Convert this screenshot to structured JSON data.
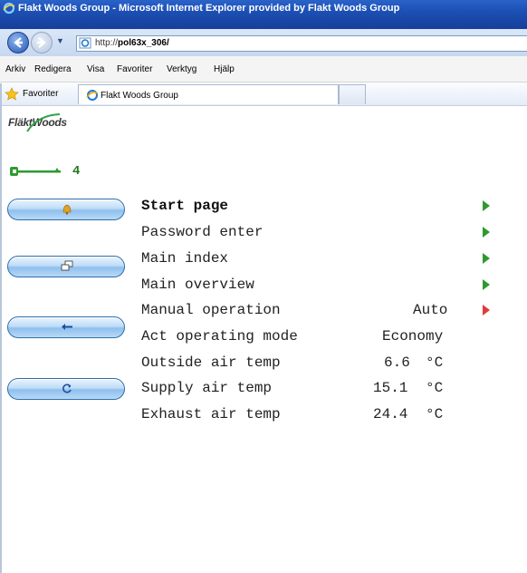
{
  "window": {
    "title": "Flakt Woods Group - Microsoft Internet Explorer provided by Flakt Woods Group",
    "url_prefix": "http://",
    "url_host": "pol63x_306/"
  },
  "menu": [
    "Arkiv",
    "Redigera",
    "Visa",
    "Favoriter",
    "Verktyg",
    "Hjälp"
  ],
  "favorites": {
    "label": "Favoriter",
    "tab_title": "Flakt Woods Group"
  },
  "page": {
    "logo": "FläktWoods",
    "access_level": "4",
    "rows": [
      {
        "label": "Start page",
        "value": "",
        "unit": "",
        "arrow": "green"
      },
      {
        "label": "Password enter",
        "value": "",
        "unit": "",
        "arrow": "green"
      },
      {
        "label": "Main index",
        "value": "",
        "unit": "",
        "arrow": "green"
      },
      {
        "label": "Main overview",
        "value": "",
        "unit": "",
        "arrow": "green"
      },
      {
        "label": "Manual operation",
        "value": "Auto",
        "unit": "",
        "arrow": "red"
      },
      {
        "label": "Act operating mode",
        "value": "Economy",
        "unit": "",
        "arrow": ""
      },
      {
        "label": "Outside air temp",
        "value": "6.6",
        "unit": "°C",
        "arrow": ""
      },
      {
        "label": "Supply air temp",
        "value": "15.1",
        "unit": "°C",
        "arrow": ""
      },
      {
        "label": "Exhaust air temp",
        "value": "24.4",
        "unit": "°C",
        "arrow": ""
      }
    ],
    "side_buttons": [
      "alarm-bell-icon",
      "windows-icon",
      "back-arrow-icon",
      "refresh-icon"
    ]
  },
  "colors": {
    "titlebar": "#1c4fb4",
    "key_green": "#1f7a1f",
    "arrow_green": "#2e9a2e",
    "arrow_red": "#e23a3a",
    "button_border": "#2e6ea8"
  }
}
